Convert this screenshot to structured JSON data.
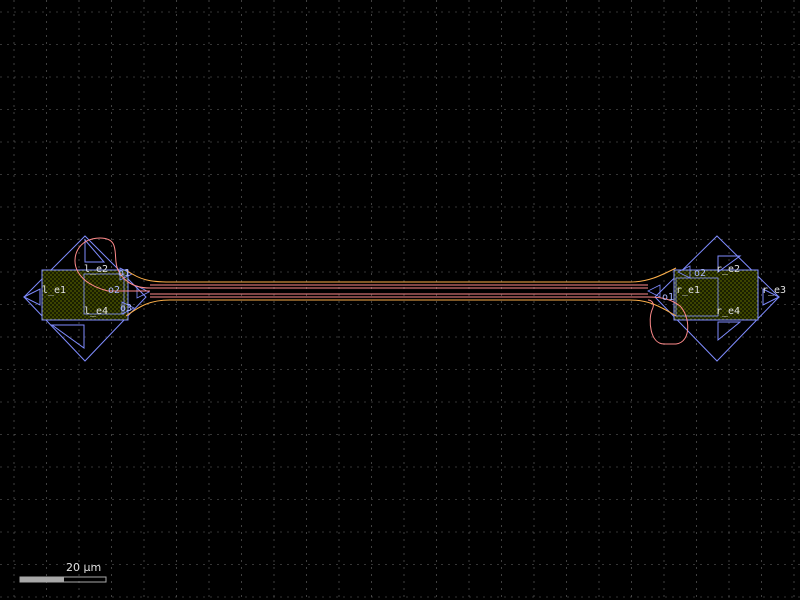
{
  "view": {
    "background": "#000000",
    "grid_color": "#6a6a6a"
  },
  "colors": {
    "outline": "#7f8cff",
    "fill_hatch": "#8fa000",
    "waveguide_pink": "#ff8a8a",
    "waveguide_orange": "#ffb14a",
    "label_light": "#e0e0e0",
    "label_blue": "#a9b7ff"
  },
  "layout": {
    "left_ports": {
      "e1": "l_e1",
      "e2": "l_e2",
      "e3": "l_e3",
      "e4": "l_e4"
    },
    "right_ports": {
      "e1": "r_e1",
      "e2": "r_e2",
      "e3": "r_e3",
      "e4": "r_e4"
    },
    "left_inner_labels": {
      "o1": "o1",
      "o2": "o2",
      "o3": "o3"
    },
    "right_inner_labels": {
      "o1": "o1",
      "o2": "o2"
    }
  },
  "scale_bar": {
    "value": 20,
    "unit": "µm",
    "label": "20 µm"
  }
}
